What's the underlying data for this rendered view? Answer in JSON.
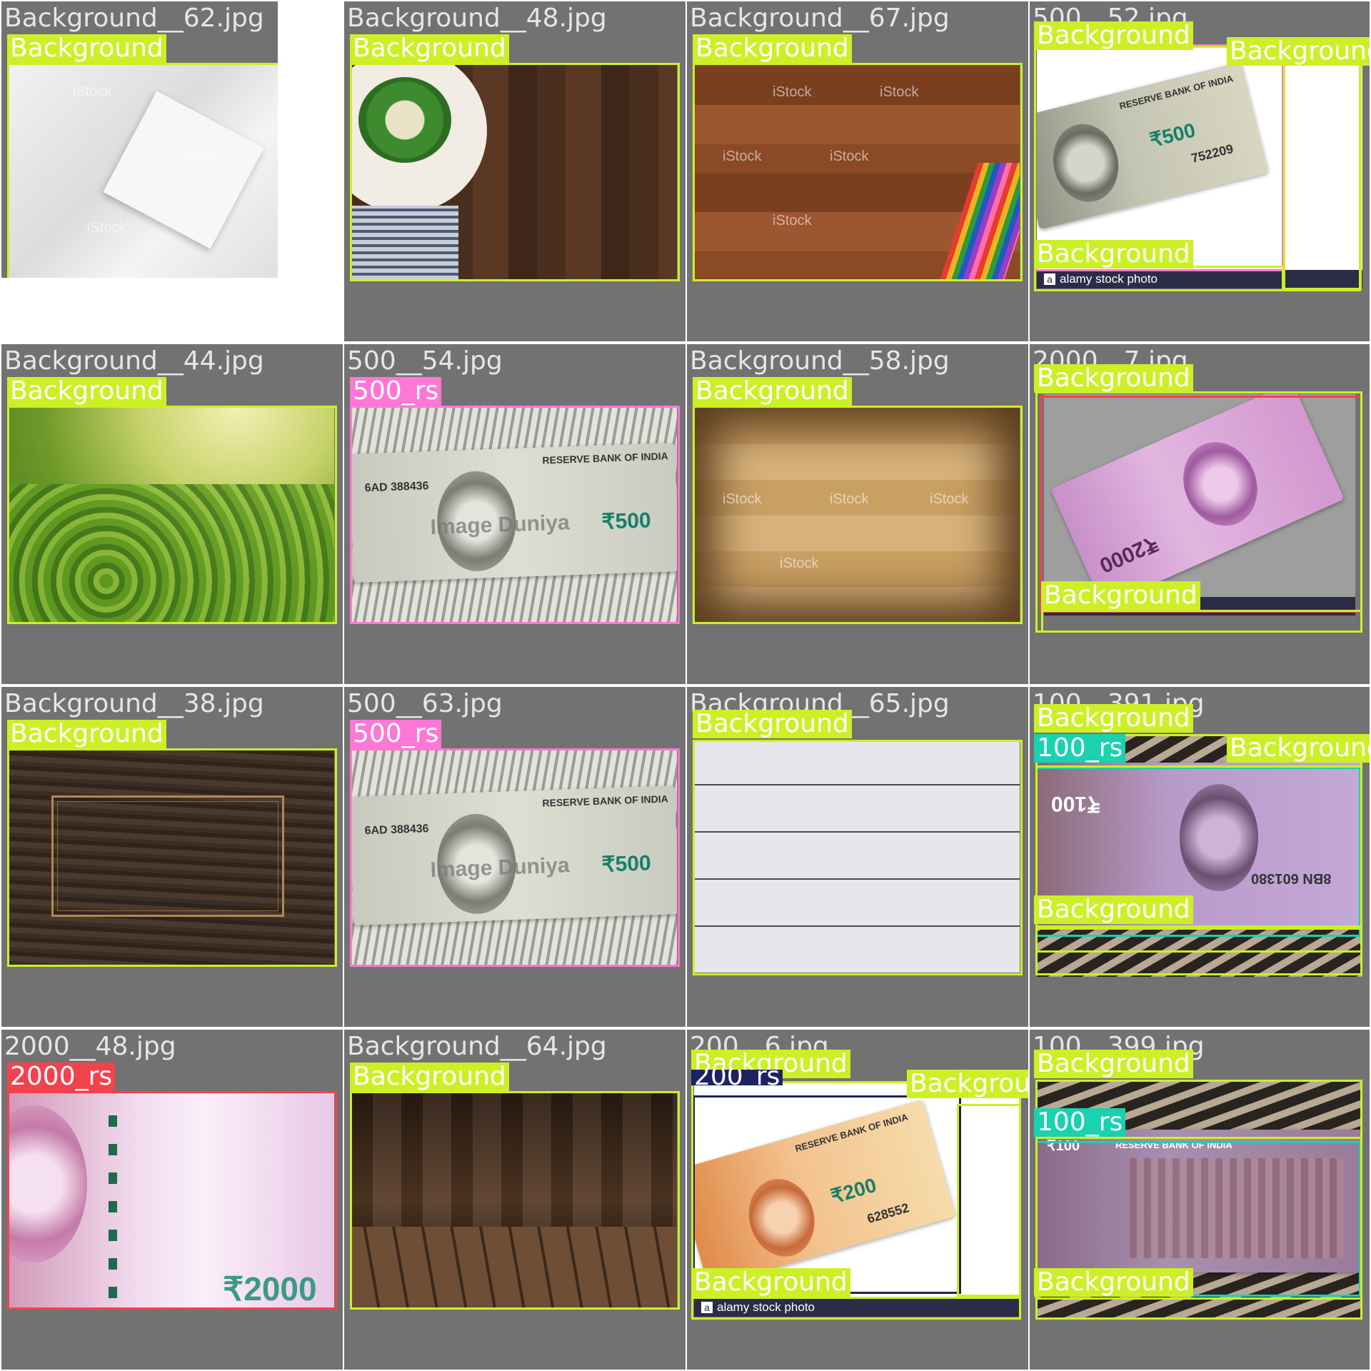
{
  "colors": {
    "tile_bg": "#727272",
    "Background": "#ccf026",
    "500_rs": "#ff77d6",
    "2000_rs": "#f2424c",
    "100_rs": "#1ad1b0",
    "200_rs": "#1c2460"
  },
  "tiles": [
    {
      "filename": "Background__62.jpg",
      "labels": [
        "Background"
      ]
    },
    {
      "filename": "Background__48.jpg",
      "labels": [
        "Background"
      ]
    },
    {
      "filename": "Background__67.jpg",
      "labels": [
        "Background"
      ]
    },
    {
      "filename": "500__52.jpg",
      "labels": [
        "Background",
        "Background",
        "Background"
      ],
      "watermark": "alamy stock photo"
    },
    {
      "filename": "Background__44.jpg",
      "labels": [
        "Background"
      ]
    },
    {
      "filename": "500__54.jpg",
      "labels": [
        "500_rs"
      ]
    },
    {
      "filename": "Background__58.jpg",
      "labels": [
        "Background"
      ]
    },
    {
      "filename": "2000__7.jpg",
      "labels": [
        "Background",
        "Background"
      ],
      "watermark": "alamy stock photo"
    },
    {
      "filename": "Background__38.jpg",
      "labels": [
        "Background"
      ]
    },
    {
      "filename": "500__63.jpg",
      "labels": [
        "500_rs"
      ]
    },
    {
      "filename": "Background__65.jpg",
      "labels": [
        "Background"
      ]
    },
    {
      "filename": "100__391.jpg",
      "labels": [
        "Background",
        "100_rs",
        "Background",
        "Background"
      ]
    },
    {
      "filename": "2000__48.jpg",
      "labels": [
        "2000_rs"
      ]
    },
    {
      "filename": "Background__64.jpg",
      "labels": [
        "Background"
      ]
    },
    {
      "filename": "200__6.jpg",
      "labels": [
        "Background",
        "200_rs",
        "Background",
        "Background"
      ],
      "watermark": "alamy stock photo"
    },
    {
      "filename": "100__399.jpg",
      "labels": [
        "Background",
        "100_rs",
        "Background"
      ]
    }
  ],
  "note_text": {
    "rbi": "RESERVE BANK OF INDIA",
    "r500": "₹500",
    "r2000": "₹2000",
    "r200": "₹200",
    "r100": "₹100",
    "serial_500": "752209",
    "serial_500b": "6AD 388436",
    "serial_200": "628552",
    "serial_100": "8BN 601380",
    "imageduniya": "Image Duniya",
    "istock": "iStock"
  }
}
